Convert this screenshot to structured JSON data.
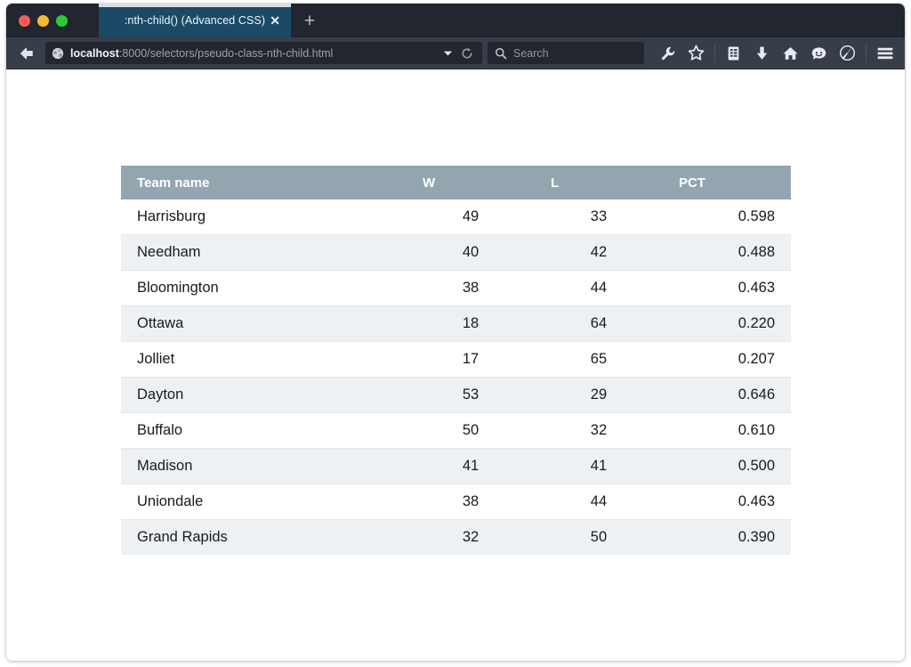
{
  "window": {
    "traffic_lights": [
      {
        "name": "close",
        "color": "#f95d53"
      },
      {
        "name": "minimize",
        "color": "#f6bc2f"
      },
      {
        "name": "zoom",
        "color": "#2cc93c"
      }
    ]
  },
  "tabbar": {
    "active_tab_title": ":nth-child() (Advanced CSS)",
    "close_glyph": "✕",
    "new_tab_glyph": "+"
  },
  "navbar": {
    "url_host": "localhost",
    "url_rest": ":8000/selectors/pseudo-class-nth-child.html",
    "search_placeholder": "Search",
    "icons": [
      "wrench-icon",
      "star-icon",
      "reader-icon",
      "download-icon",
      "home-icon",
      "chat-icon",
      "firebug-icon",
      "hamburger-menu-icon"
    ]
  },
  "table": {
    "columns": [
      "Team name",
      "W",
      "L",
      "PCT"
    ],
    "rows": [
      {
        "team": "Harrisburg",
        "w": "49",
        "l": "33",
        "pct": "0.598"
      },
      {
        "team": "Needham",
        "w": "40",
        "l": "42",
        "pct": "0.488"
      },
      {
        "team": "Bloomington",
        "w": "38",
        "l": "44",
        "pct": "0.463"
      },
      {
        "team": "Ottawa",
        "w": "18",
        "l": "64",
        "pct": "0.220"
      },
      {
        "team": "Jolliet",
        "w": "17",
        "l": "65",
        "pct": "0.207"
      },
      {
        "team": "Dayton",
        "w": "53",
        "l": "29",
        "pct": "0.646"
      },
      {
        "team": "Buffalo",
        "w": "50",
        "l": "32",
        "pct": "0.610"
      },
      {
        "team": "Madison",
        "w": "41",
        "l": "41",
        "pct": "0.500"
      },
      {
        "team": "Uniondale",
        "w": "38",
        "l": "44",
        "pct": "0.463"
      },
      {
        "team": "Grand Rapids",
        "w": "32",
        "l": "50",
        "pct": "0.390"
      }
    ]
  },
  "colors": {
    "chrome_dark": "#22262e",
    "toolbar": "#373d49",
    "active_tab": "#1b4a66",
    "tab_accent": "#d5dfe6",
    "table_header": "#93a6b0",
    "table_stripe": "#eef1f3"
  }
}
